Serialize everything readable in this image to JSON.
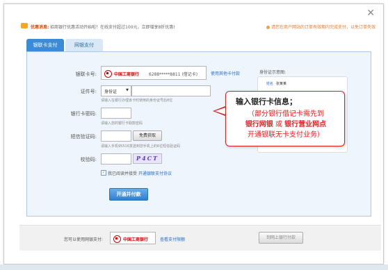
{
  "window": {
    "close_icon": "close-icon"
  },
  "promo": {
    "label": "优惠消息:",
    "text": "招商银行优惠活动开始啦！在线支付超过100元，立即增享8折优惠!",
    "right_text": "请您在商户网站的订单有效期内完成支付，以免订单失效"
  },
  "tabs": [
    {
      "label": "银联卡支付",
      "active": true
    },
    {
      "label": "网银支付",
      "active": false
    }
  ],
  "form": {
    "card_label": "银联卡号:",
    "bank_name": "中国工商银行",
    "card_number": "6288*****8811 (借记卡)",
    "change_card_link": "使用其他卡付款",
    "id_label": "证件号:",
    "id_type": "身份证",
    "id_hint": "请输入在银行办理该卡时使用的身份证号后8位",
    "pwd_label": "银行卡密码:",
    "pwd_hint": "请输入您的银行卡取款密码",
    "sms_label": "短信验证码:",
    "sms_button": "免费获取",
    "sms_hint": "请输入手机95516发送到您手机上的6位短信验证码",
    "captcha_label": "校验码:",
    "captcha_text": "P4CT",
    "agree_text": "我已阅读并接受",
    "agree_link": "开通银联支付协议",
    "submit": "开通并付款"
  },
  "idcard_sample": {
    "title": "身份证示意图:",
    "name_label": "姓名",
    "name_value": "张某某"
  },
  "tooltip": {
    "line1": "输入银行卡信息；",
    "line2": "（部分银行借记卡需先到",
    "line3_a": "银行网银",
    "line3_b": " 或 ",
    "line3_c": "银行营业网点",
    "line4": "开通银联无卡支付业务）"
  },
  "footer": {
    "label": "您可以使用网银支付:",
    "bank_name": "中国工商银行",
    "link": "查看支付限额",
    "button": "到网上银行付款"
  },
  "colors": {
    "accent": "#3b8bd6",
    "alert": "#e02020",
    "panel_bg": "#eef5fc"
  }
}
